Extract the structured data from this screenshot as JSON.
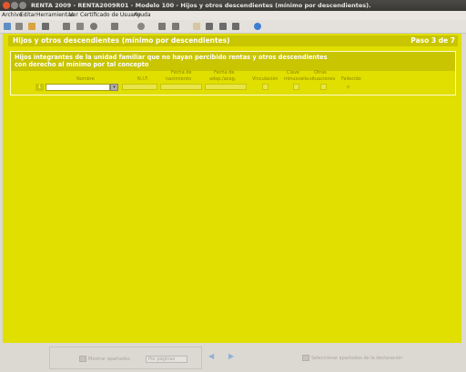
{
  "window": {
    "title": "RENTA 2009 - RENTA2009R01 - Modelo 100 - Hijos y otros descendientes (mínimo por descendientes)."
  },
  "menu": [
    "Archivo",
    "Editar",
    "Herramientas",
    "Ver",
    "Certificado de Usuario",
    "Ayuda"
  ],
  "toolbar": {
    "icons": [
      "new-icon",
      "open-icon",
      "folder-icon",
      "save-icon",
      "print-icon",
      "calc-icon",
      "disk-icon",
      "disk2-icon",
      "doc-icon",
      "edit-icon",
      "list-icon",
      "table-icon",
      "grid-icon",
      "help-icon"
    ]
  },
  "page": {
    "heading": "Hijos y otros descendientes (mínimo por descendientes)",
    "step": "Paso 3 de 7"
  },
  "section": {
    "title_line1": "Hijos integrantes de la unidad familiar que no hayan percibido rentas y otros descendientes",
    "title_line2": "con derecho al mínimo por tal concepto",
    "columns": {
      "nombre": "Nombre",
      "nif": "N.I.F.",
      "fecha_nac_1": "Fecha de",
      "fecha_nac_2": "nacimiento",
      "fecha_adop_1": "Fecha de",
      "fecha_adop_2": "adop./acog.",
      "vinculacion": "Vinculación",
      "clave_1": "Clave",
      "clave_2": "minusvalía",
      "otras_1": "Otras",
      "otras_2": "situaciones",
      "fallecido": "Fallecido"
    },
    "row": {
      "number": "1",
      "nombre": "",
      "dropdown_icon": "chevron-down-icon"
    }
  },
  "bottom": {
    "show_sections_label": "Mostrar apartados",
    "pages_select": "Por páginas",
    "select_sections_label": "Seleccionar apartados de la declaración"
  },
  "colors": {
    "accent": "#e1df00",
    "header": "#c9c500"
  }
}
